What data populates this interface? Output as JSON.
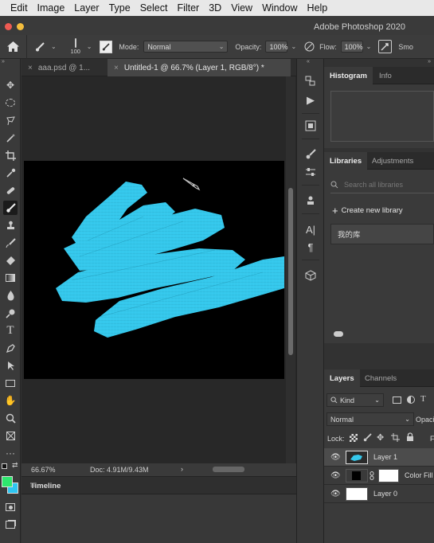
{
  "menu": [
    "Edit",
    "Image",
    "Layer",
    "Type",
    "Select",
    "Filter",
    "3D",
    "View",
    "Window",
    "Help"
  ],
  "app_title": "Adobe Photoshop 2020",
  "options": {
    "brush_size": "100",
    "mode_label": "Mode:",
    "mode_value": "Normal",
    "opacity_label": "Opacity:",
    "opacity_value": "100%",
    "flow_label": "Flow:",
    "flow_value": "100%",
    "smoothing_label": "Smo"
  },
  "tabs": [
    {
      "label": "aaa.psd @ 1...",
      "active": false
    },
    {
      "label": "Untitled-1 @ 66.7% (Layer 1, RGB/8°) *",
      "active": true
    }
  ],
  "status": {
    "zoom": "66.67%",
    "doc": "Doc: 4.91M/9.43M",
    "arrow": "›"
  },
  "timeline": {
    "title": "Timeline"
  },
  "panels": {
    "histogram_tabs": [
      "Histogram",
      "Info"
    ],
    "libraries_tabs": [
      "Libraries",
      "Adjustments"
    ],
    "library_search_placeholder": "Search all libraries",
    "create_library": "Create new library",
    "library_item": "我的库",
    "layers_tabs": [
      "Layers",
      "Channels"
    ],
    "kind": "Kind",
    "blend_mode": "Normal",
    "opacity_short": "Opaci",
    "lock_label": "Lock:",
    "fill_short": "F",
    "layers": [
      {
        "name": "Layer 1",
        "selected": true
      },
      {
        "name": "Color Fill",
        "selected": false
      },
      {
        "name": "Layer 0",
        "selected": false
      }
    ]
  },
  "colors": {
    "brush_stroke": "#35c8ec",
    "foreground": "#2ee66e",
    "background": "#2ec6f2"
  }
}
